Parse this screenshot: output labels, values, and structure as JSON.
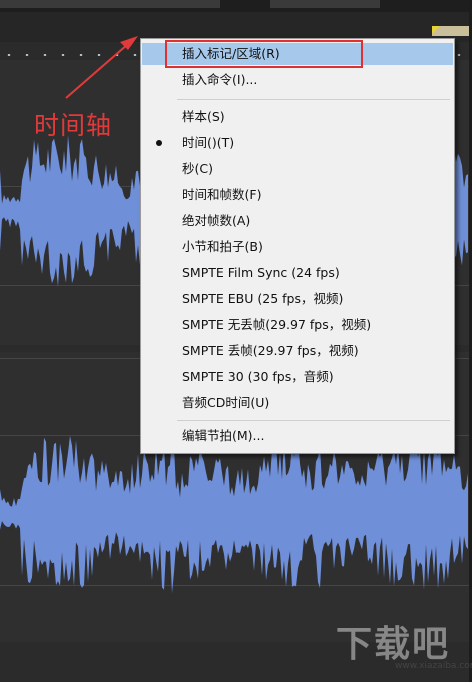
{
  "colors": {
    "background": "#2b2b2b",
    "waveform": "#6f8fd8",
    "menu_bg": "#f0f0f0",
    "menu_highlight": "#a6c8ea",
    "annotation": "#e23a3a"
  },
  "annotation": {
    "label": "时间轴"
  },
  "context_menu": {
    "items": [
      {
        "label": "插入标记/区域(R)",
        "highlighted": true
      },
      {
        "label": "插入命令(I)..."
      },
      {
        "label": "样本(S)"
      },
      {
        "label": "时间()(T)",
        "checked": true
      },
      {
        "label": "秒(C)"
      },
      {
        "label": "时间和帧数(F)"
      },
      {
        "label": "绝对帧数(A)"
      },
      {
        "label": "小节和拍子(B)"
      },
      {
        "label": "SMPTE Film Sync (24 fps)"
      },
      {
        "label": "SMPTE EBU (25 fps，视频)"
      },
      {
        "label": "SMPTE 无丢帧(29.97 fps，视频)"
      },
      {
        "label": "SMPTE 丢帧(29.97 fps，视频)"
      },
      {
        "label": "SMPTE 30 (30 fps，音频)"
      },
      {
        "label": "音频CD时间(U)"
      },
      {
        "label": "编辑节拍(M)..."
      }
    ]
  },
  "watermark": {
    "text": "下载吧",
    "url": "www.xiazaiba.com"
  }
}
